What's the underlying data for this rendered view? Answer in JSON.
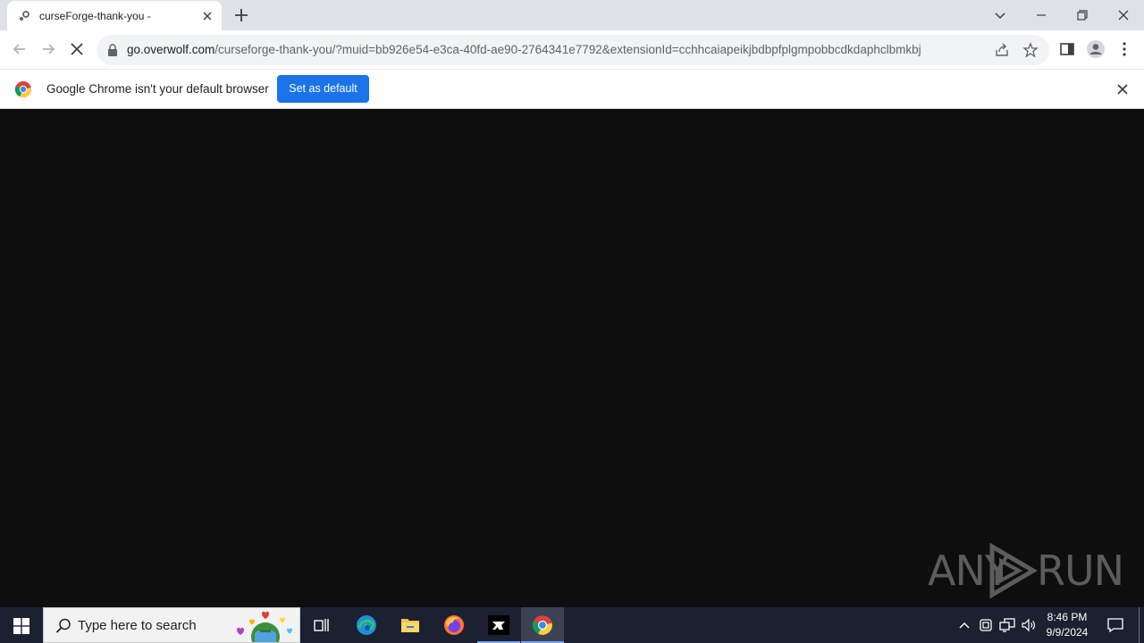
{
  "browser": {
    "tab": {
      "title": "curseForge-thank-you -"
    },
    "url": {
      "host": "go.overwolf.com",
      "path": "/curseforge-thank-you/?muid=bb926e54-e3ca-40fd-ae90-2764341e7792&extensionId=cchhcaiapeikjbdbpfplgmpobbcdkdaphclbmkbj"
    }
  },
  "infobar": {
    "message": "Google Chrome isn't your default browser",
    "button_label": "Set as default"
  },
  "watermark": {
    "left": "ANY",
    "right": "RUN"
  },
  "taskbar": {
    "search_placeholder": "Type here to search",
    "time": "8:46 PM",
    "date": "9/9/2024"
  },
  "colors": {
    "accent": "#1a73e8",
    "page_background": "#0e0e0e",
    "taskbar": "#1b2130"
  },
  "icons": [
    "favicon",
    "tab-close-icon",
    "new-tab-icon",
    "tab-search-icon",
    "minimize-icon",
    "restore-icon",
    "window-close-icon",
    "back-icon",
    "forward-icon",
    "stop-loading-icon",
    "lock-icon",
    "share-icon",
    "bookmark-star-icon",
    "side-panel-icon",
    "profile-icon",
    "menu-kebab-icon",
    "chrome-logo-icon",
    "infobar-close-icon",
    "windows-start-icon",
    "search-icon",
    "task-view-icon",
    "edge-icon",
    "file-explorer-icon",
    "firefox-icon",
    "app-icon",
    "chrome-icon",
    "tray-chevron-icon",
    "tray-app-icon",
    "network-icon",
    "volume-icon",
    "notification-icon"
  ]
}
